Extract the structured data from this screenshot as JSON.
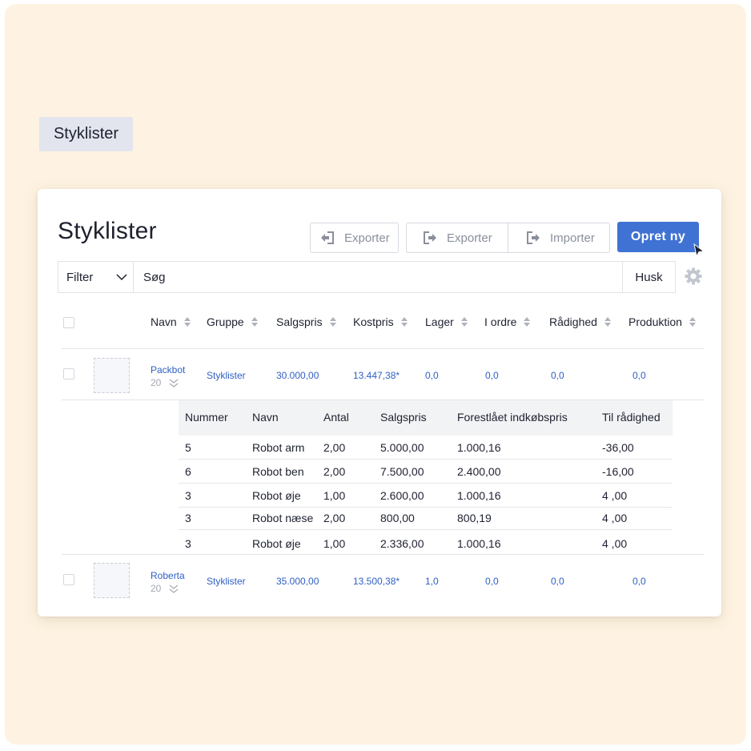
{
  "page_tag": "Styklister",
  "card": {
    "title": "Styklister",
    "buttons": {
      "export_left": "Exporter",
      "export": "Exporter",
      "import": "Importer",
      "create": "Opret ny"
    },
    "filter_label": "Filter",
    "search_value": "Søg",
    "remember_label": "Husk"
  },
  "columns": [
    "Navn",
    "Gruppe",
    "Salgspris",
    "Kostpris",
    "Lager",
    "I ordre",
    "Rådighed",
    "Produktion"
  ],
  "rows": [
    {
      "name": "Packbot",
      "count": "20",
      "group": "Styklister",
      "sale_price": "30.000,00",
      "cost_price": "13.447,38*",
      "stock": "0,0",
      "in_order": "0,0",
      "available": "0,0",
      "production": "0,0"
    },
    {
      "name": "Roberta",
      "count": "20",
      "group": "Styklister",
      "sale_price": "35.000,00",
      "cost_price": "13.500,38*",
      "stock": "1,0",
      "in_order": "0,0",
      "available": "0,0",
      "production": "0,0"
    }
  ],
  "sub_table": {
    "headers": [
      "Nummer",
      "Navn",
      "Antal",
      "Salgspris",
      "Forestlået indkøbspris",
      "Til rådighed"
    ],
    "rows": [
      [
        "5",
        "Robot arm",
        "2,00",
        "5.000,00",
        "1.000,16",
        "-36,00"
      ],
      [
        "6",
        "Robot ben",
        "2,00",
        "7.500,00",
        "2.400,00",
        "-16,00"
      ],
      [
        "3",
        "Robot øje",
        "1,00",
        "2.600,00",
        "1.000,16",
        "4 ,00"
      ],
      [
        "3",
        "Robot næse",
        "2,00",
        "800,00",
        "800,19",
        "4 ,00"
      ],
      [
        "3",
        "Robot øje",
        "1,00",
        "2.336,00",
        "1.000,16",
        "4 ,00"
      ]
    ]
  },
  "colors": {
    "background": "#fef3e2",
    "accent": "#3f72d3",
    "link": "#2f5fc4"
  },
  "icons": [
    "import-arrow-icon",
    "export-arrow-icon",
    "chevron-down-icon",
    "gear-icon",
    "sort-icon",
    "cursor-icon"
  ]
}
